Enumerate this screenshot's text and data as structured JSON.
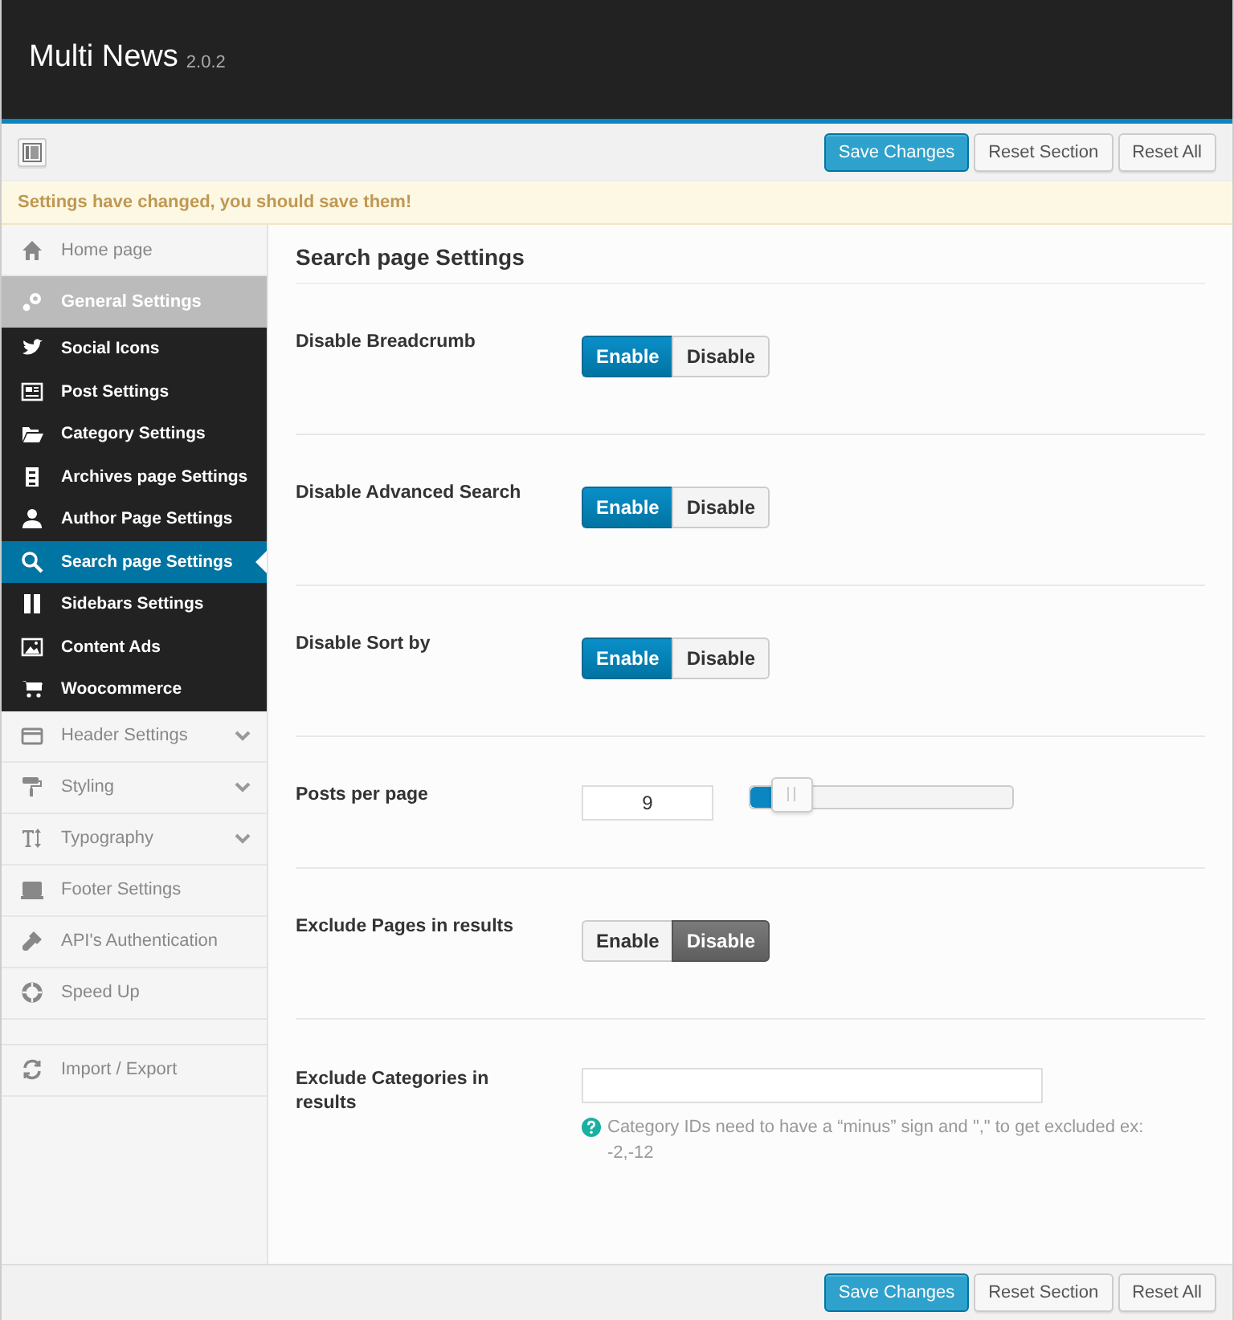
{
  "header": {
    "title": "Multi News",
    "version": "2.0.2"
  },
  "toolbar": {
    "buttons": [
      {
        "label": "Save Changes",
        "kind": "primary"
      },
      {
        "label": "Reset Section",
        "kind": "default"
      },
      {
        "label": "Reset All",
        "kind": "default"
      }
    ]
  },
  "notice": "Settings have changed, you should save them!",
  "sidebar": {
    "groups": [
      [
        {
          "label": "Home page",
          "selected": false
        },
        {
          "label": "General Settings",
          "selected": false,
          "expanded": true,
          "children": [
            {
              "label": "Social Icons",
              "selected": false
            },
            {
              "label": "Post Settings",
              "selected": false
            },
            {
              "label": "Category Settings",
              "selected": false
            },
            {
              "label": "Archives page Settings",
              "selected": false
            },
            {
              "label": "Author Page Settings",
              "selected": false
            },
            {
              "label": "Search page Settings",
              "selected": true
            },
            {
              "label": "Sidebars Settings",
              "selected": false
            },
            {
              "label": "Content Ads",
              "selected": false
            },
            {
              "label": "Woocommerce",
              "selected": false
            }
          ]
        },
        {
          "label": "Header Settings",
          "selected": false,
          "expanded": false
        },
        {
          "label": "Styling",
          "selected": false,
          "expanded": false
        },
        {
          "label": "Typography",
          "selected": false,
          "expanded": false
        },
        {
          "label": "Footer Settings",
          "selected": false
        },
        {
          "label": "API's Authentication",
          "selected": false
        },
        {
          "label": "Speed Up",
          "selected": false
        }
      ],
      [
        {
          "label": "Import / Export",
          "selected": false
        }
      ]
    ]
  },
  "section_title": "Search page Settings",
  "fields": [
    {
      "kind": "toggle",
      "label": "Disable Breadcrumb",
      "options": [
        {
          "label": "Enable",
          "selected": true
        },
        {
          "label": "Disable",
          "selected": false
        }
      ]
    },
    {
      "kind": "toggle",
      "label": "Disable Advanced Search",
      "options": [
        {
          "label": "Enable",
          "selected": true
        },
        {
          "label": "Disable",
          "selected": false
        }
      ]
    },
    {
      "kind": "toggle",
      "label": "Disable Sort by",
      "options": [
        {
          "label": "Enable",
          "selected": true
        },
        {
          "label": "Disable",
          "selected": false
        }
      ]
    },
    {
      "kind": "slider",
      "label": "Posts per page",
      "value": "9",
      "level": 0.09
    },
    {
      "kind": "toggle",
      "label": "Exclude Pages in results",
      "options": [
        {
          "label": "Enable",
          "selected": false
        },
        {
          "label": "Disable",
          "selected": true
        }
      ]
    },
    {
      "kind": "text",
      "label": "Exclude Categories in results",
      "help": "Category IDs need to have a “minus” sign and \",\" to get excluded ex: -2,-12"
    }
  ],
  "footer": {
    "buttons": [
      {
        "label": "Save Changes",
        "kind": "primary"
      },
      {
        "label": "Reset Section",
        "kind": "default"
      },
      {
        "label": "Reset All",
        "kind": "default"
      }
    ]
  }
}
